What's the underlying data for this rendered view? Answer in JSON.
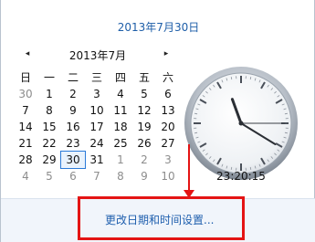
{
  "header": {
    "full_date": "2013年7月30日"
  },
  "calendar": {
    "month_label": "2013年7月",
    "prev_glyph": "◂",
    "next_glyph": "▸",
    "weekdays": [
      "日",
      "一",
      "二",
      "三",
      "四",
      "五",
      "六"
    ],
    "weeks": [
      [
        "30",
        "1",
        "2",
        "3",
        "4",
        "5",
        "6"
      ],
      [
        "7",
        "8",
        "9",
        "10",
        "11",
        "12",
        "13"
      ],
      [
        "14",
        "15",
        "16",
        "17",
        "18",
        "19",
        "20"
      ],
      [
        "21",
        "22",
        "23",
        "24",
        "25",
        "26",
        "27"
      ],
      [
        "28",
        "29",
        "30",
        "31",
        "1",
        "2",
        "3"
      ],
      [
        "4",
        "5",
        "6",
        "7",
        "8",
        "9",
        "10"
      ]
    ],
    "selected": "30"
  },
  "clock": {
    "time": "23:20:15",
    "hours": 23,
    "minutes": 20,
    "seconds": 15
  },
  "footer": {
    "settings_link": "更改日期和时间设置..."
  },
  "colors": {
    "accent": "#1f5fae",
    "annotation": "#e41414"
  }
}
